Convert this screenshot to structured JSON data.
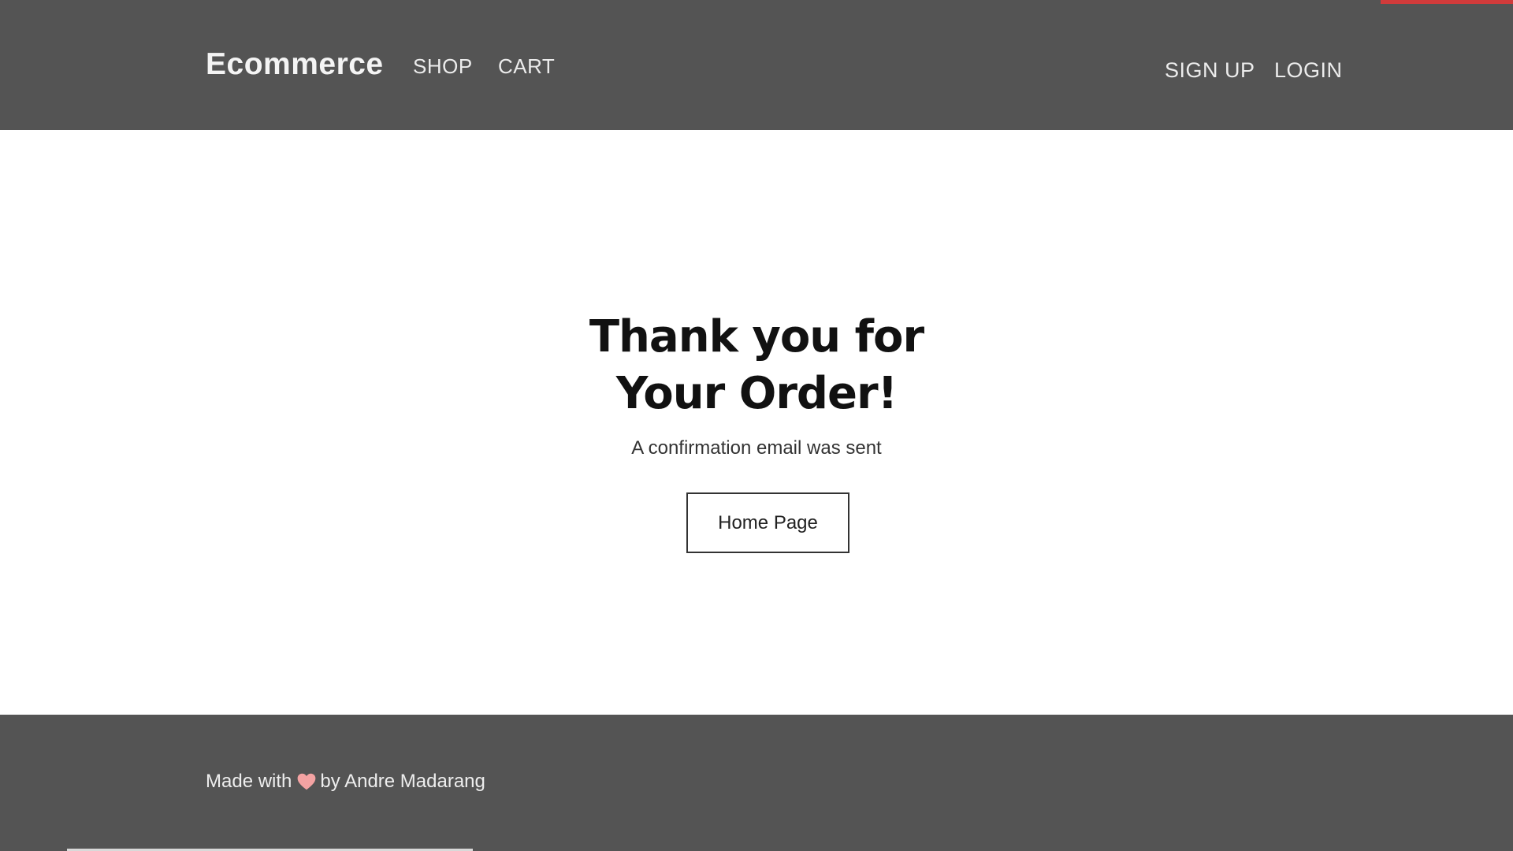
{
  "header": {
    "brand": "Ecommerce",
    "nav_left": [
      "SHOP",
      "CART"
    ],
    "nav_right": [
      "SIGN UP",
      "LOGIN"
    ]
  },
  "main": {
    "heading_line1": "Thank you for",
    "heading_line2": "Your Order!",
    "subtext": "A confirmation email was sent",
    "button_label": "Home Page"
  },
  "footer": {
    "text_before": "Made with",
    "icon": "heart-icon",
    "text_after": "by Andre Madarang",
    "heart_color": "#f4a3a3"
  },
  "colors": {
    "header_bg": "#545454",
    "footer_bg": "#545454",
    "accent": "#d13b3b"
  }
}
